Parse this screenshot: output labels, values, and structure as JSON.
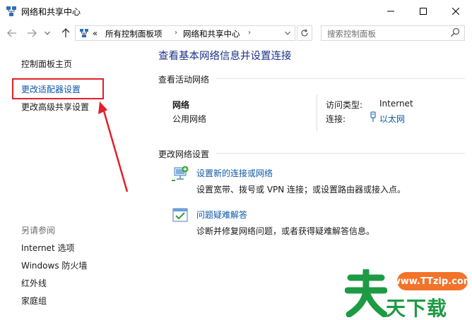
{
  "window": {
    "title": "网络和共享中心"
  },
  "address_bar": {
    "overflow": "«",
    "segments": [
      "所有控制面板项",
      "网络和共享中心"
    ],
    "search_placeholder": "搜索控制面板"
  },
  "sidebar": {
    "home": "控制面板主页",
    "links": [
      "更改适配器设置",
      "更改高级共享设置"
    ],
    "see_also_heading": "另请参阅",
    "see_also": [
      "Internet 选项",
      "Windows 防火墙",
      "红外线",
      "家庭组"
    ]
  },
  "main": {
    "title": "查看基本网络信息并设置连接",
    "active_networks_heading": "查看活动网络",
    "network": {
      "name": "网络",
      "profile": "公用网络",
      "access_type_label": "访问类型:",
      "access_type_value": "Internet",
      "connections_label": "连接:",
      "connection_link": "以太网"
    },
    "change_settings_heading": "更改网络设置",
    "tasks": [
      {
        "icon": "new-connection-icon",
        "link": "设置新的连接或网络",
        "desc": "设置宽带、拨号或 VPN 连接；或设置路由器或接入点。"
      },
      {
        "icon": "troubleshoot-icon",
        "link": "问题疑难解答",
        "desc": "诊断并修复网络问题，或者获得疑难解答信息。"
      }
    ]
  },
  "watermark": {
    "url": "www.TTzip.com",
    "logo_char": "天",
    "text": "天下载"
  },
  "colors": {
    "link": "#0d58a8",
    "title": "#1e3287",
    "annotation": "#e0202a",
    "watermark_green": "#1f9a44",
    "watermark_orange": "#f3732a"
  }
}
